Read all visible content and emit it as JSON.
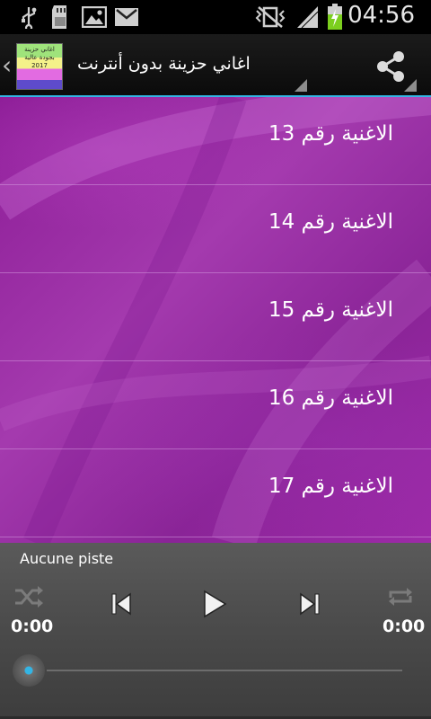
{
  "status_bar": {
    "time": "04:56",
    "icons": [
      "usb-icon",
      "sd-card-icon",
      "image-icon",
      "gmail-icon",
      "vibrate-icon",
      "signal-icon",
      "battery-charging-icon"
    ]
  },
  "action_bar": {
    "title": "اغاني حزينة بدون أنترنت",
    "logo_text": "اغاني حزينة بجودة عالية 2017",
    "accent_color": "#33b5e5"
  },
  "songs": [
    {
      "label": "الاغنية رقم 13"
    },
    {
      "label": "الاغنية رقم 14"
    },
    {
      "label": "الاغنية رقم 15"
    },
    {
      "label": "الاغنية رقم 16"
    },
    {
      "label": "الاغنية رقم 17"
    }
  ],
  "player": {
    "track_name": "Aucune piste",
    "elapsed": "0:00",
    "duration": "0:00",
    "progress": 0
  }
}
